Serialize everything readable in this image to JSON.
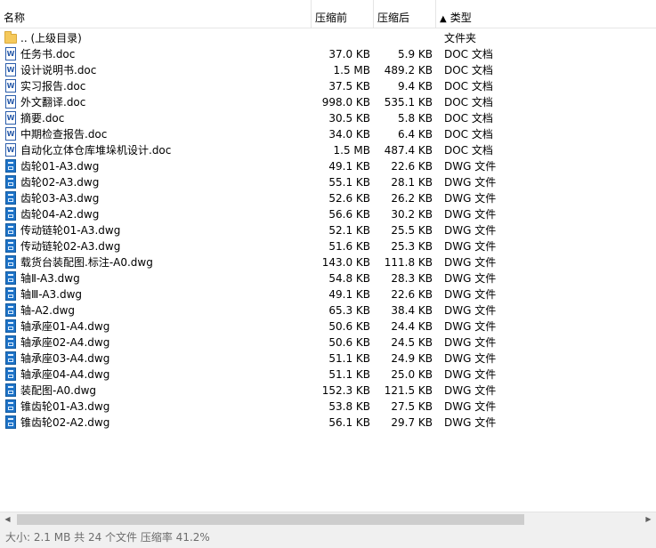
{
  "columns": {
    "name": "名称",
    "size": "压缩前",
    "packed": "压缩后",
    "sort_arrow": "▲",
    "type": "类型"
  },
  "files": [
    {
      "icon": "folder-icon",
      "name": ".. (上级目录)",
      "size": "",
      "packed": "",
      "type": "文件夹"
    },
    {
      "icon": "word-doc-icon",
      "name": "任务书.doc",
      "size": "37.0 KB",
      "packed": "5.9 KB",
      "type": "DOC 文档"
    },
    {
      "icon": "word-doc-icon",
      "name": "设计说明书.doc",
      "size": "1.5 MB",
      "packed": "489.2 KB",
      "type": "DOC 文档"
    },
    {
      "icon": "word-doc-icon",
      "name": "实习报告.doc",
      "size": "37.5 KB",
      "packed": "9.4 KB",
      "type": "DOC 文档"
    },
    {
      "icon": "word-doc-icon",
      "name": "外文翻译.doc",
      "size": "998.0 KB",
      "packed": "535.1 KB",
      "type": "DOC 文档"
    },
    {
      "icon": "word-doc-icon",
      "name": "摘要.doc",
      "size": "30.5 KB",
      "packed": "5.8 KB",
      "type": "DOC 文档"
    },
    {
      "icon": "word-doc-icon",
      "name": "中期检查报告.doc",
      "size": "34.0 KB",
      "packed": "6.4 KB",
      "type": "DOC 文档"
    },
    {
      "icon": "word-doc-icon",
      "name": "自动化立体仓库堆垛机设计.doc",
      "size": "1.5 MB",
      "packed": "487.4 KB",
      "type": "DOC 文档"
    },
    {
      "icon": "dwg-file-icon",
      "name": "齿轮01-A3.dwg",
      "size": "49.1 KB",
      "packed": "22.6 KB",
      "type": "DWG 文件"
    },
    {
      "icon": "dwg-file-icon",
      "name": "齿轮02-A3.dwg",
      "size": "55.1 KB",
      "packed": "28.1 KB",
      "type": "DWG 文件"
    },
    {
      "icon": "dwg-file-icon",
      "name": "齿轮03-A3.dwg",
      "size": "52.6 KB",
      "packed": "26.2 KB",
      "type": "DWG 文件"
    },
    {
      "icon": "dwg-file-icon",
      "name": "齿轮04-A2.dwg",
      "size": "56.6 KB",
      "packed": "30.2 KB",
      "type": "DWG 文件"
    },
    {
      "icon": "dwg-file-icon",
      "name": "传动链轮01-A3.dwg",
      "size": "52.1 KB",
      "packed": "25.5 KB",
      "type": "DWG 文件"
    },
    {
      "icon": "dwg-file-icon",
      "name": "传动链轮02-A3.dwg",
      "size": "51.6 KB",
      "packed": "25.3 KB",
      "type": "DWG 文件"
    },
    {
      "icon": "dwg-file-icon",
      "name": "载货台装配图.标注-A0.dwg",
      "size": "143.0 KB",
      "packed": "111.8 KB",
      "type": "DWG 文件"
    },
    {
      "icon": "dwg-file-icon",
      "name": "轴Ⅱ-A3.dwg",
      "size": "54.8 KB",
      "packed": "28.3 KB",
      "type": "DWG 文件"
    },
    {
      "icon": "dwg-file-icon",
      "name": "轴Ⅲ-A3.dwg",
      "size": "49.1 KB",
      "packed": "22.6 KB",
      "type": "DWG 文件"
    },
    {
      "icon": "dwg-file-icon",
      "name": "轴-A2.dwg",
      "size": "65.3 KB",
      "packed": "38.4 KB",
      "type": "DWG 文件"
    },
    {
      "icon": "dwg-file-icon",
      "name": "轴承座01-A4.dwg",
      "size": "50.6 KB",
      "packed": "24.4 KB",
      "type": "DWG 文件"
    },
    {
      "icon": "dwg-file-icon",
      "name": "轴承座02-A4.dwg",
      "size": "50.6 KB",
      "packed": "24.5 KB",
      "type": "DWG 文件"
    },
    {
      "icon": "dwg-file-icon",
      "name": "轴承座03-A4.dwg",
      "size": "51.1 KB",
      "packed": "24.9 KB",
      "type": "DWG 文件"
    },
    {
      "icon": "dwg-file-icon",
      "name": "轴承座04-A4.dwg",
      "size": "51.1 KB",
      "packed": "25.0 KB",
      "type": "DWG 文件"
    },
    {
      "icon": "dwg-file-icon",
      "name": "装配图-A0.dwg",
      "size": "152.3 KB",
      "packed": "121.5 KB",
      "type": "DWG 文件"
    },
    {
      "icon": "dwg-file-icon",
      "name": "锥齿轮01-A3.dwg",
      "size": "53.8 KB",
      "packed": "27.5 KB",
      "type": "DWG 文件"
    },
    {
      "icon": "dwg-file-icon",
      "name": "锥齿轮02-A2.dwg",
      "size": "56.1 KB",
      "packed": "29.7 KB",
      "type": "DWG 文件"
    }
  ],
  "scrollbar": {
    "left_arrow": "◀",
    "right_arrow": "▶"
  },
  "status": {
    "text": "大小: 2.1 MB 共 24 个文件 压缩率 41.2%"
  }
}
